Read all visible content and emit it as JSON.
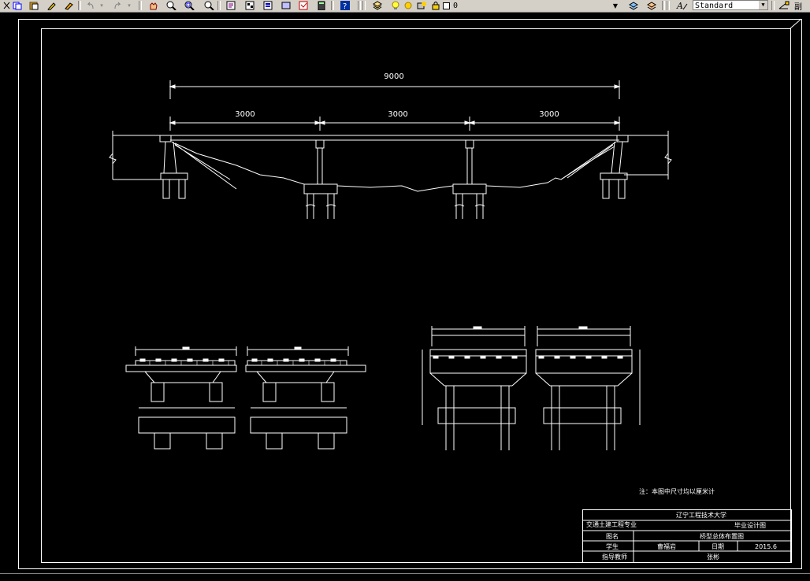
{
  "toolbar": {
    "layer_value": "0",
    "text_style": "Standard",
    "right_label": "副"
  },
  "drawing": {
    "dim_total": "9000",
    "dim_span1": "3000",
    "dim_span2": "3000",
    "dim_span3": "3000",
    "note": "注：本图中尺寸均以厘米计",
    "title_block": {
      "school": "辽宁工程技术大学",
      "major": "交通土建工程专业",
      "design_type": "毕业设计图",
      "drawing_name_label": "图名",
      "drawing_name": "桥型总体布置图",
      "student_label": "学生",
      "student": "曹福岩",
      "date_label": "日期",
      "date": "2015.6",
      "advisor_label": "指导教师",
      "advisor": "张彬"
    }
  },
  "colors": {
    "background": "#000000",
    "lines": "#ffffff",
    "toolbar": "#d4d0c8"
  }
}
